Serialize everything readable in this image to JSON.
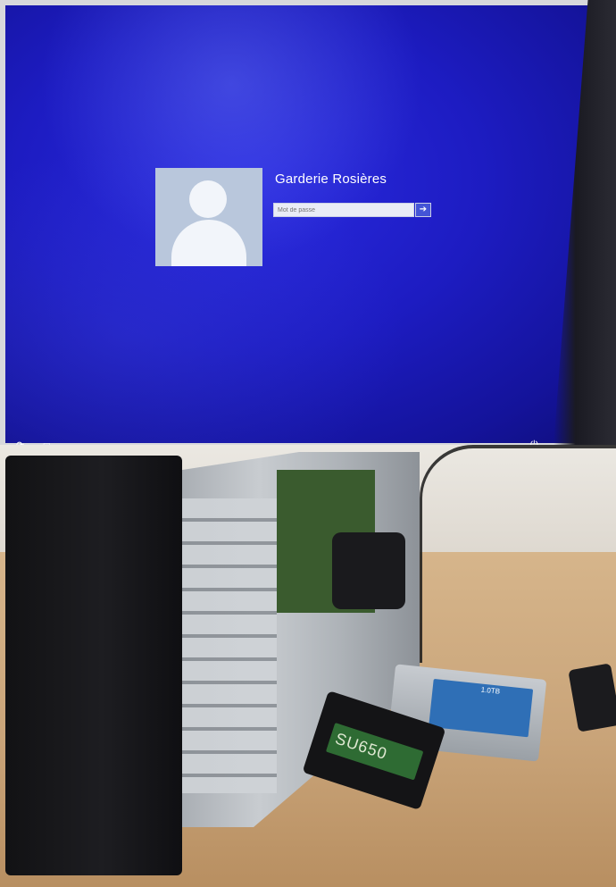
{
  "login_screen": {
    "user_name": "Garderie Rosières",
    "password_placeholder": "Mot de passe",
    "submit_glyph": "➔"
  },
  "icons": {
    "ease_of_access": "ease-of-access-icon",
    "keyboard_layout": "keyboard-icon",
    "shutdown": "power-icon"
  },
  "hardware_labels": {
    "ssd_model": "SU650",
    "hdd_capacity": "1.0TB"
  },
  "colors": {
    "screen_blue": "#1d1cc2",
    "desk_wood": "#c9a479"
  }
}
